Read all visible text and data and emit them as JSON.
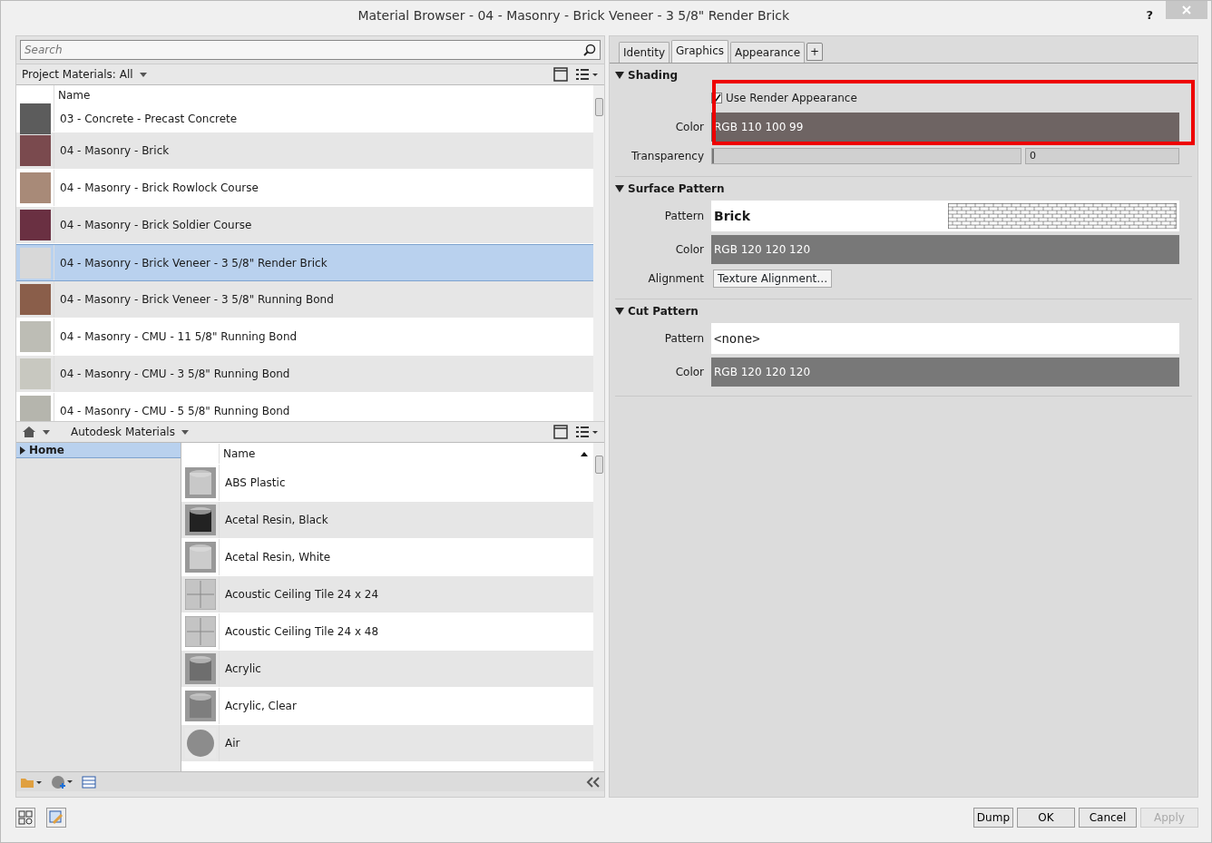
{
  "window": {
    "title": "Material Browser - 04 - Masonry - Brick Veneer - 3 5/8\" Render Brick",
    "help": "?"
  },
  "search": {
    "placeholder": "Search"
  },
  "project_materials": {
    "breadcrumb": "Project Materials: All",
    "column": "Name",
    "rows": [
      {
        "name": "03 - Concrete - Precast Concrete",
        "color": "#5c5c5c",
        "selected": false
      },
      {
        "name": "04 - Masonry - Brick",
        "color": "#7a4a4e",
        "selected": false
      },
      {
        "name": "04 - Masonry - Brick Rowlock Course",
        "color": "#a88a78",
        "selected": false
      },
      {
        "name": "04 - Masonry - Brick Soldier Course",
        "color": "#6a3042",
        "selected": false
      },
      {
        "name": "04 - Masonry - Brick Veneer - 3 5/8\" Render Brick",
        "color": "#d8d8d8",
        "selected": true
      },
      {
        "name": "04 - Masonry - Brick Veneer - 3 5/8\" Running Bond",
        "color": "#8a5e4a",
        "selected": false
      },
      {
        "name": "04 - Masonry - CMU - 11 5/8\" Running Bond",
        "color": "#bdbdb5",
        "selected": false
      },
      {
        "name": "04 - Masonry - CMU - 3 5/8\" Running Bond",
        "color": "#c8c8c0",
        "selected": false
      },
      {
        "name": "04 - Masonry - CMU - 5 5/8\" Running Bond",
        "color": "#b5b5ad",
        "selected": false
      }
    ]
  },
  "library": {
    "breadcrumb": "Autodesk Materials",
    "tree": [
      {
        "label": "Home",
        "selected": true,
        "expanded": false
      }
    ],
    "column": "Name",
    "rows": [
      {
        "name": "ABS Plastic",
        "kind": "cylinder",
        "color": "#c8c8c8"
      },
      {
        "name": "Acetal Resin, Black",
        "kind": "cylinder",
        "color": "#222222"
      },
      {
        "name": "Acetal Resin, White",
        "kind": "cylinder",
        "color": "#cccccc"
      },
      {
        "name": "Acoustic Ceiling Tile 24 x 24",
        "kind": "tile",
        "color": "#c4c4c4"
      },
      {
        "name": "Acoustic Ceiling Tile 24 x 48",
        "kind": "tile",
        "color": "#c4c4c4"
      },
      {
        "name": "Acrylic",
        "kind": "cylinder",
        "color": "#6e6e6e"
      },
      {
        "name": "Acrylic, Clear",
        "kind": "cylinder",
        "color": "#7e7e7e"
      },
      {
        "name": "Air",
        "kind": "sphere",
        "color": "#8c8c8c"
      }
    ]
  },
  "tabs": [
    {
      "label": "Identity",
      "selected": false
    },
    {
      "label": "Graphics",
      "selected": true
    },
    {
      "label": "Appearance",
      "selected": false
    }
  ],
  "add_tab": "+",
  "sections": [
    {
      "title": "Shading",
      "expanded": true,
      "fields": [
        {
          "kind": "checkbox",
          "label": "Use Render Appearance",
          "checked": true
        },
        {
          "kind": "color",
          "label": "Color",
          "value": "RGB 110 100 99",
          "color": "#6e6463"
        },
        {
          "kind": "slider",
          "label": "Transparency",
          "level": 0,
          "value": "0"
        }
      ]
    },
    {
      "title": "Surface Pattern",
      "expanded": true,
      "fields": [
        {
          "kind": "pattern",
          "label": "Pattern",
          "value": "Brick",
          "preview": true
        },
        {
          "kind": "color",
          "label": "Color",
          "value": "RGB 120 120 120",
          "color": "#787878"
        },
        {
          "kind": "button",
          "label": "Alignment",
          "value": "Texture Alignment…"
        }
      ]
    },
    {
      "title": "Cut Pattern",
      "expanded": true,
      "fields": [
        {
          "kind": "pattern",
          "label": "Pattern",
          "value": "<none>",
          "preview": false
        },
        {
          "kind": "color",
          "label": "Color",
          "value": "RGB 120 120 120",
          "color": "#787878"
        }
      ]
    }
  ],
  "buttons": [
    {
      "label": "Dump",
      "disabled": false
    },
    {
      "label": "OK",
      "disabled": false
    },
    {
      "label": "Cancel",
      "disabled": false
    },
    {
      "label": "Apply",
      "disabled": true
    }
  ]
}
